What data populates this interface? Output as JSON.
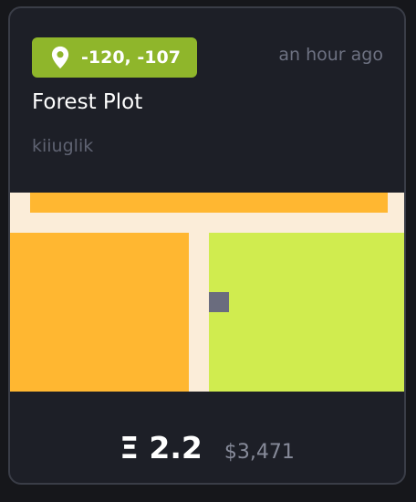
{
  "parcel": {
    "coordinates": "-120, -107",
    "time_ago": "an hour ago",
    "name": "Forest Plot",
    "owner": "kiiuglik"
  },
  "icons": {
    "location": "map-pin-icon"
  },
  "map": {
    "colors": {
      "road": "#fbedd9",
      "district": "#ffb731",
      "parcel": "#d0ec4f",
      "marker": "#6a6c7e"
    }
  },
  "price": {
    "eth": "Ξ 2.2",
    "usd": "$3,471"
  },
  "colors": {
    "badge": "#8fb62b",
    "card_bg": "#1d1f27",
    "border": "#3a3d47"
  }
}
